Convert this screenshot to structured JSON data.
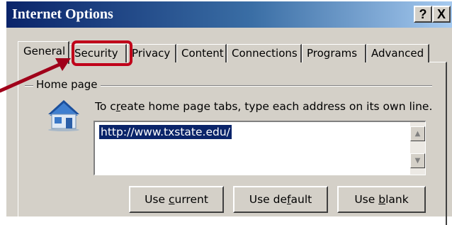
{
  "window": {
    "title": "Internet Options",
    "help_button": "?",
    "close_button": "X"
  },
  "tabs": [
    {
      "label": "General",
      "active": true
    },
    {
      "label": "Security",
      "active": false,
      "highlighted": true
    },
    {
      "label": "Privacy",
      "active": false
    },
    {
      "label": "Content",
      "active": false
    },
    {
      "label": "Connections",
      "active": false
    },
    {
      "label": "Programs",
      "active": false
    },
    {
      "label": "Advanced",
      "active": false
    }
  ],
  "home_page": {
    "group_label": "Home page",
    "instructions_pre": "To c",
    "instructions_u": "r",
    "instructions_post": "eate home page tabs, type each address on its own line.",
    "url": "http://www.txstate.edu/",
    "icon": "house-icon"
  },
  "buttons": {
    "use_current": {
      "pre": "Use ",
      "u": "c",
      "post": "urrent"
    },
    "use_default": {
      "pre": "Use de",
      "u": "f",
      "post": "ault"
    },
    "use_blank": {
      "pre": "Use ",
      "u": "b",
      "post": "lank"
    }
  },
  "annotation": {
    "highlight_color": "#c0001a",
    "arrow_color": "#a0001a"
  },
  "colors": {
    "titlebar_start": "#0a246a",
    "titlebar_end": "#a6caf0",
    "dialog_bg": "#d4d0c8",
    "selection_bg": "#0a246a"
  }
}
